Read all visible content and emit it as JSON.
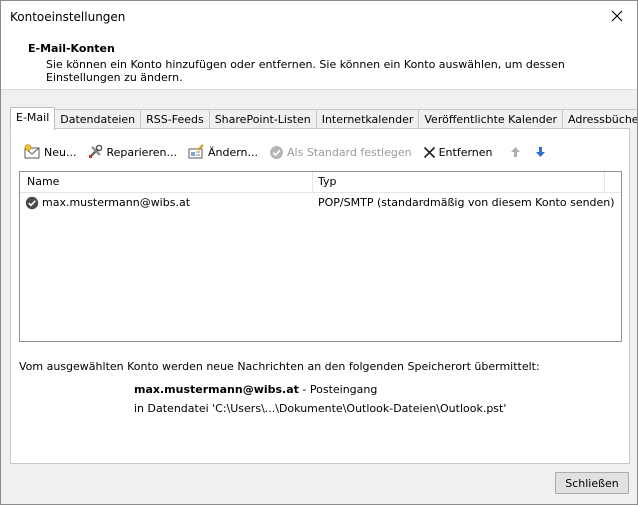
{
  "window": {
    "title": "Kontoeinstellungen"
  },
  "header": {
    "title": "E-Mail-Konten",
    "description": "Sie können ein Konto hinzufügen oder entfernen. Sie können ein Konto auswählen, um dessen Einstellungen zu ändern."
  },
  "tabs": [
    {
      "label": "E-Mail",
      "active": true
    },
    {
      "label": "Datendateien"
    },
    {
      "label": "RSS-Feeds"
    },
    {
      "label": "SharePoint-Listen"
    },
    {
      "label": "Internetkalender"
    },
    {
      "label": "Veröffentlichte Kalender"
    },
    {
      "label": "Adressbücher"
    }
  ],
  "toolbar": {
    "new_label": "Neu...",
    "repair_label": "Reparieren...",
    "change_label": "Ändern...",
    "default_label": "Als Standard festlegen",
    "remove_label": "Entfernen"
  },
  "list": {
    "columns": {
      "name": "Name",
      "type": "Typ"
    },
    "rows": [
      {
        "name": "max.mustermann@wibs.at",
        "type": "POP/SMTP (standardmäßig von diesem Konto senden)"
      }
    ]
  },
  "delivery": {
    "description": "Vom ausgewählten Konto werden neue Nachrichten an den folgenden Speicherort übermittelt:",
    "account": "max.mustermann@wibs.at",
    "folder_suffix": " - Posteingang",
    "datafile_line": "in Datendatei 'C:\\Users\\...\\Dokumente\\Outlook-Dateien\\Outlook.pst'"
  },
  "footer": {
    "close_label": "Schließen"
  },
  "colors": {
    "accent_blue": "#2b6fcf",
    "disabled": "#9a9a9a"
  }
}
